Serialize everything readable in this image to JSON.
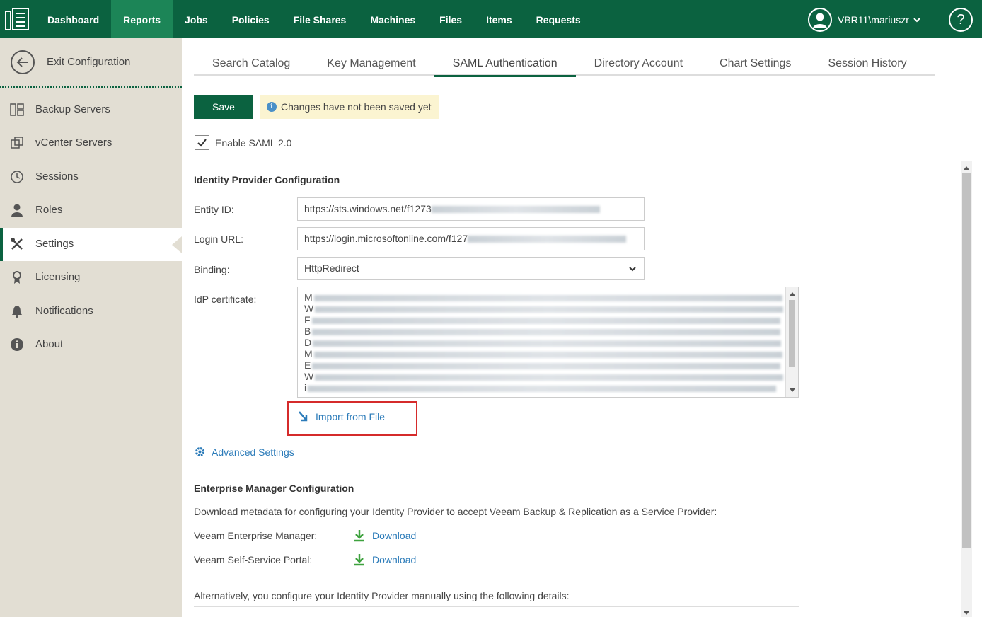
{
  "nav": {
    "items": [
      "Dashboard",
      "Reports",
      "Jobs",
      "Policies",
      "File Shares",
      "Machines",
      "Files",
      "Items",
      "Requests"
    ],
    "active": "Reports",
    "user": "VBR11\\mariuszr",
    "help_label": "?"
  },
  "sidebar": {
    "exit_label": "Exit Configuration",
    "items": [
      {
        "label": "Backup Servers",
        "icon": "backup-servers-icon"
      },
      {
        "label": "vCenter Servers",
        "icon": "vcenter-servers-icon"
      },
      {
        "label": "Sessions",
        "icon": "clock-icon"
      },
      {
        "label": "Roles",
        "icon": "user-icon"
      },
      {
        "label": "Settings",
        "icon": "tools-icon"
      },
      {
        "label": "Licensing",
        "icon": "license-icon"
      },
      {
        "label": "Notifications",
        "icon": "bell-icon"
      },
      {
        "label": "About",
        "icon": "info-icon"
      }
    ],
    "active": "Settings"
  },
  "tabs": {
    "items": [
      "Search Catalog",
      "Key Management",
      "SAML Authentication",
      "Directory Account",
      "Chart Settings",
      "Session History"
    ],
    "active": "SAML Authentication"
  },
  "toolbar": {
    "save_label": "Save",
    "notice": "Changes have not been saved yet"
  },
  "saml": {
    "enable_label": "Enable SAML 2.0",
    "enabled": true
  },
  "idp": {
    "title": "Identity Provider Configuration",
    "entity_id_label": "Entity ID:",
    "entity_id_value": "https://sts.windows.net/f1273",
    "login_url_label": "Login URL:",
    "login_url_value": "https://login.microsoftonline.com/f127",
    "binding_label": "Binding:",
    "binding_value": "HttpRedirect",
    "cert_label": "IdP certificate:",
    "cert_line_starts": [
      "M",
      "W",
      "F",
      "B",
      "D",
      "M",
      "E",
      "W",
      "i"
    ],
    "import_label": "Import from File",
    "advanced_label": "Advanced Settings"
  },
  "em": {
    "title": "Enterprise Manager Configuration",
    "description": "Download metadata for configuring your Identity Provider to accept Veeam Backup & Replication as a Service Provider:",
    "em_label": "Veeam Enterprise Manager:",
    "ssp_label": "Veeam Self-Service Portal:",
    "download_label": "Download",
    "alternative": "Alternatively, you configure your Identity Provider manually using the following details:"
  },
  "colors": {
    "brand": "#0b6240",
    "active_nav": "#1c8557",
    "link": "#2b7bb9",
    "highlight": "#d52b2b",
    "notice_bg": "#fbf4d1"
  }
}
